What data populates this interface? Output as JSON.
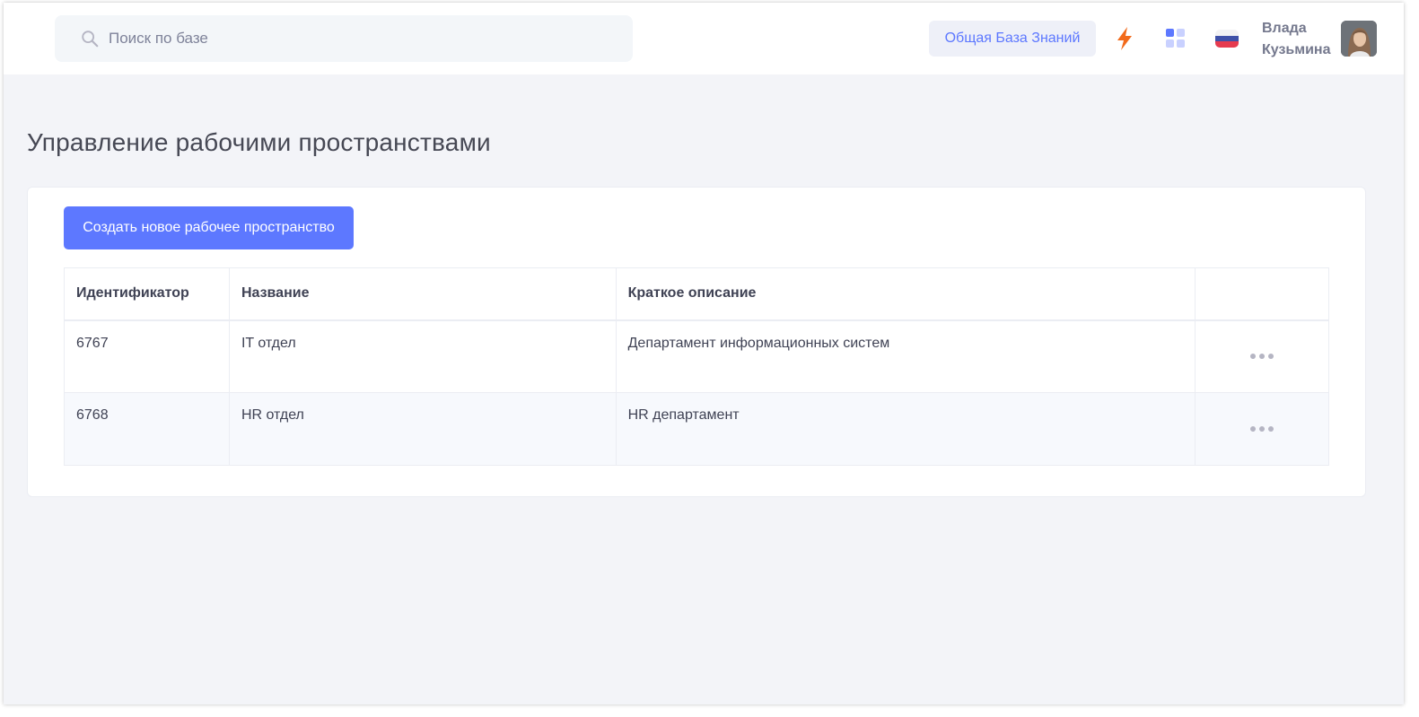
{
  "header": {
    "search_placeholder": "Поиск по базе",
    "knowledge_base_label": "Общая База Знаний",
    "icons": [
      "search-icon",
      "lightning-icon",
      "apps-grid-icon",
      "russian-flag-icon"
    ],
    "user": {
      "first_name": "Влада",
      "last_name": "Кузьмина"
    }
  },
  "page": {
    "title": "Управление рабочими пространствами",
    "create_button": "Создать новое рабочее пространство"
  },
  "table": {
    "columns": [
      "Идентификатор",
      "Название",
      "Краткое описание",
      ""
    ],
    "rows": [
      {
        "id": "6767",
        "name": "IT отдел",
        "description": "Департамент информационных систем"
      },
      {
        "id": "6768",
        "name": "HR отдел",
        "description": "HR департамент"
      }
    ]
  },
  "colors": {
    "accent": "#5d78ff",
    "lightning": "#f26a1b",
    "background": "#f3f4f8"
  }
}
